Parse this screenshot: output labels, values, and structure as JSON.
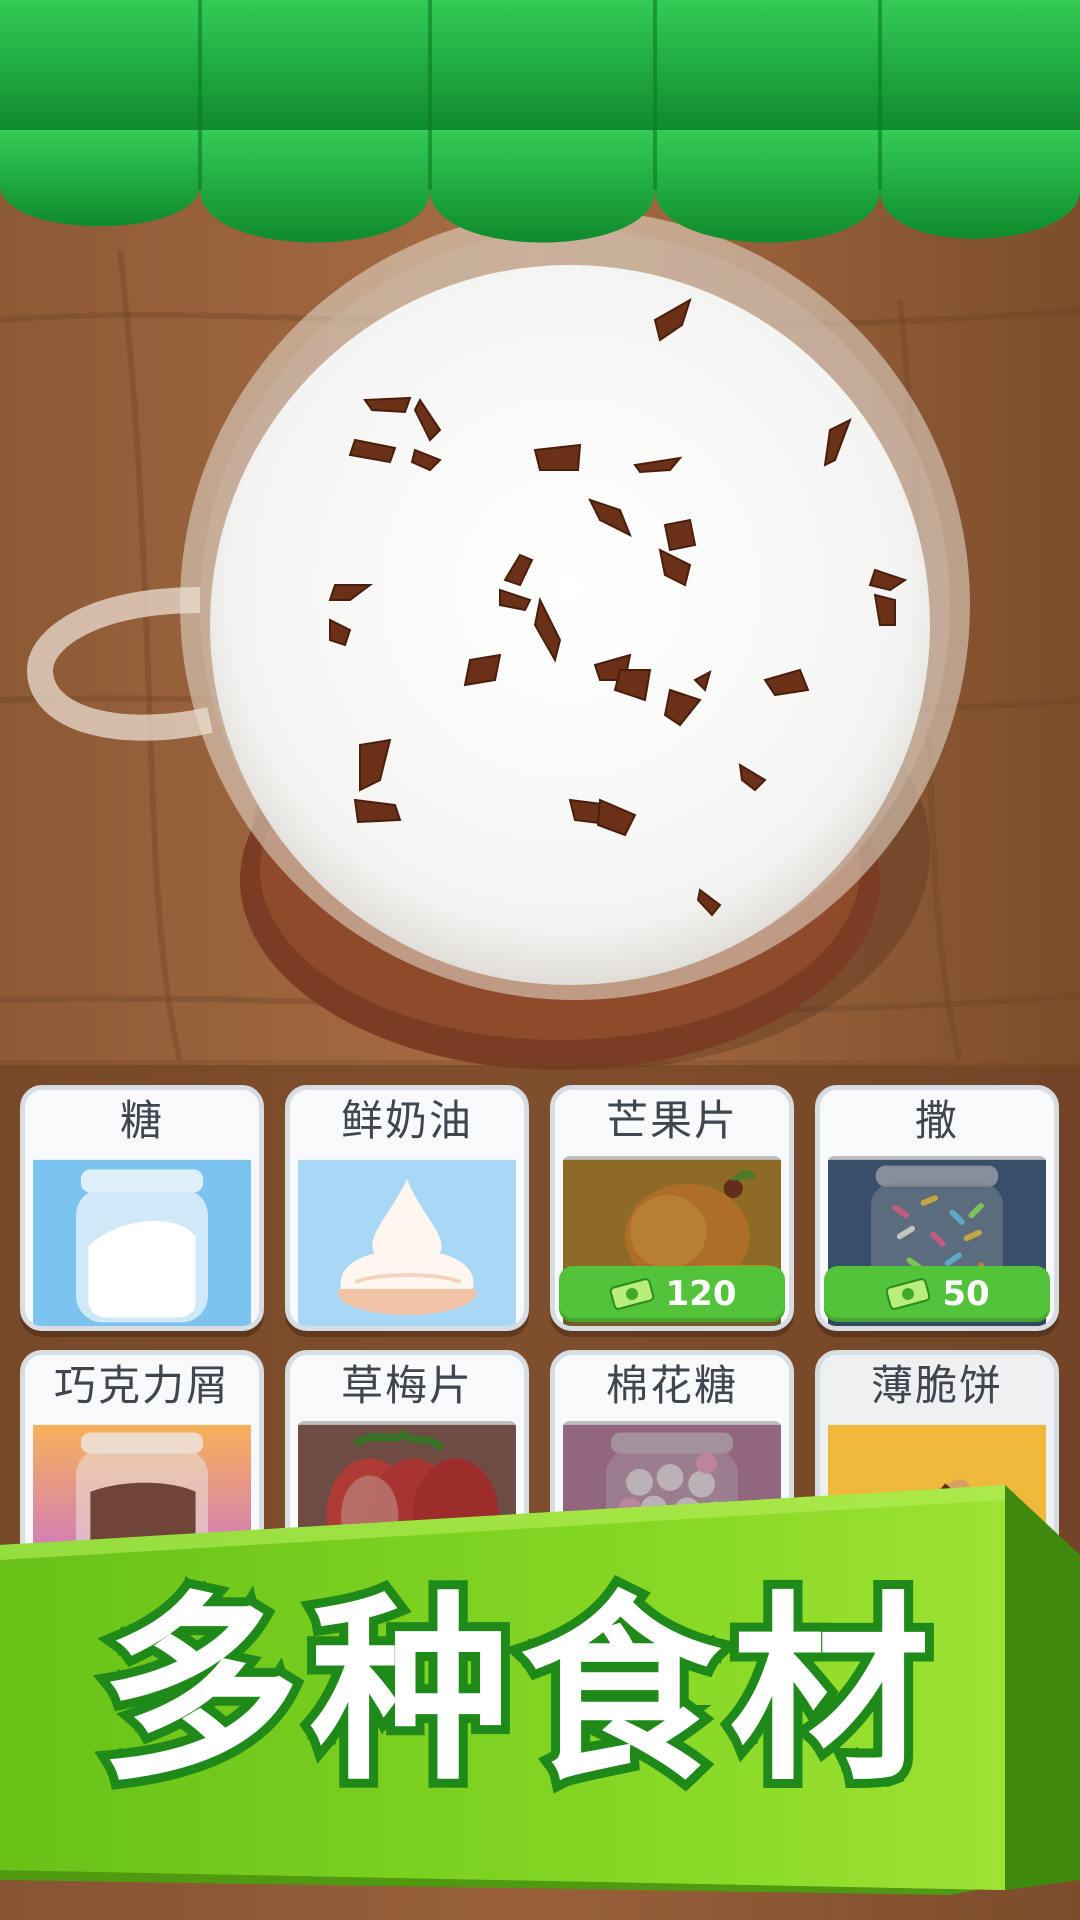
{
  "title": "多种食材",
  "ingredients": [
    {
      "name": "糖",
      "image": "sugar-jar",
      "price": null
    },
    {
      "name": "鲜奶油",
      "image": "whipped-cream",
      "price": null
    },
    {
      "name": "芒果片",
      "image": "mango",
      "price": "120"
    },
    {
      "name": "撒",
      "image": "sprinkles-jar",
      "price": "50"
    },
    {
      "name": "巧克力屑",
      "image": "chocolate-jar",
      "price": null
    },
    {
      "name": "草梅片",
      "image": "strawberry",
      "price": null
    },
    {
      "name": "棉花糖",
      "image": "marshmallow-jar",
      "price": null
    },
    {
      "name": "薄脆饼",
      "image": "wafer-rolls",
      "price": null
    }
  ],
  "colors": {
    "awning": "#1fa83a",
    "banner": "#7ed321",
    "price_bg": "#53c43a"
  }
}
